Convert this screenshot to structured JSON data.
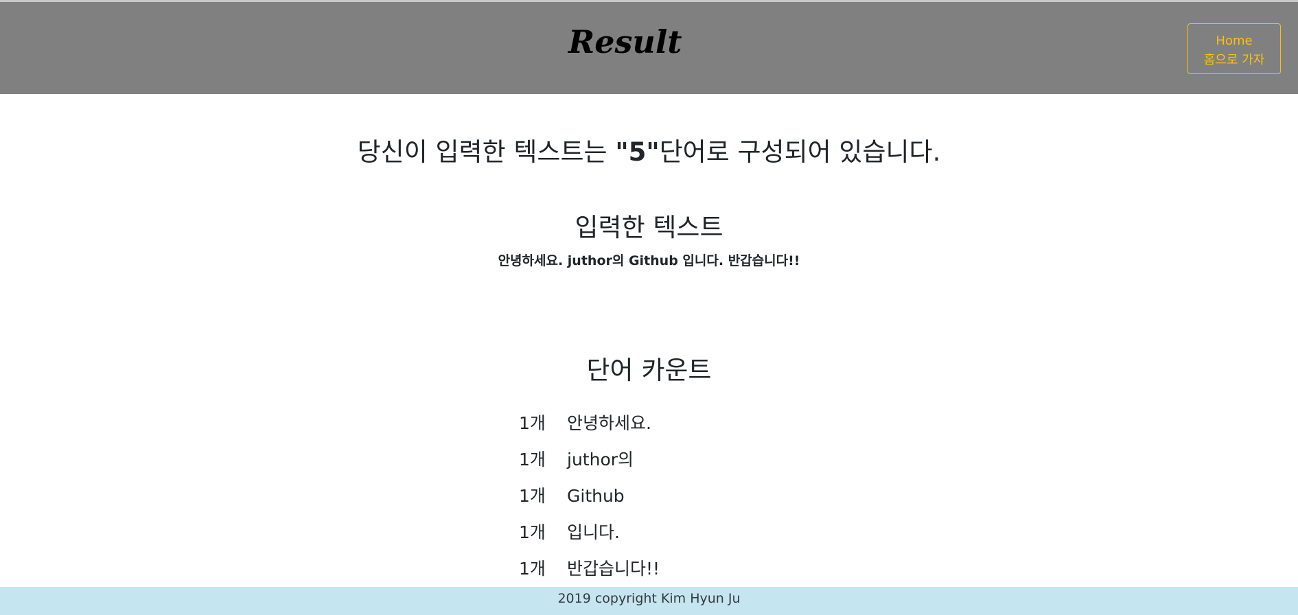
{
  "header": {
    "title": "Result",
    "home_button": {
      "line1": "Home",
      "line2": "홈으로 가자"
    }
  },
  "summary": {
    "before": "당신이 입력한 텍스트는 ",
    "count": "\"5\"",
    "after": "단어로 구성되어 있습니다."
  },
  "input_section": {
    "title": "입력한 텍스트",
    "text": "안녕하세요. juthor의 Github 입니다. 반갑습니다!!"
  },
  "count_section": {
    "title": "단어 카운트",
    "rows": [
      {
        "count": "1개",
        "word": "안녕하세요."
      },
      {
        "count": "1개",
        "word": "juthor의"
      },
      {
        "count": "1개",
        "word": "Github"
      },
      {
        "count": "1개",
        "word": "입니다."
      },
      {
        "count": "1개",
        "word": "반갑습니다!!"
      }
    ]
  },
  "footer": {
    "text": "2019 copyright Kim Hyun Ju"
  },
  "colors": {
    "header_bg": "#808080",
    "accent_warning": "#ffc107",
    "footer_bg": "#c5e5f0"
  }
}
